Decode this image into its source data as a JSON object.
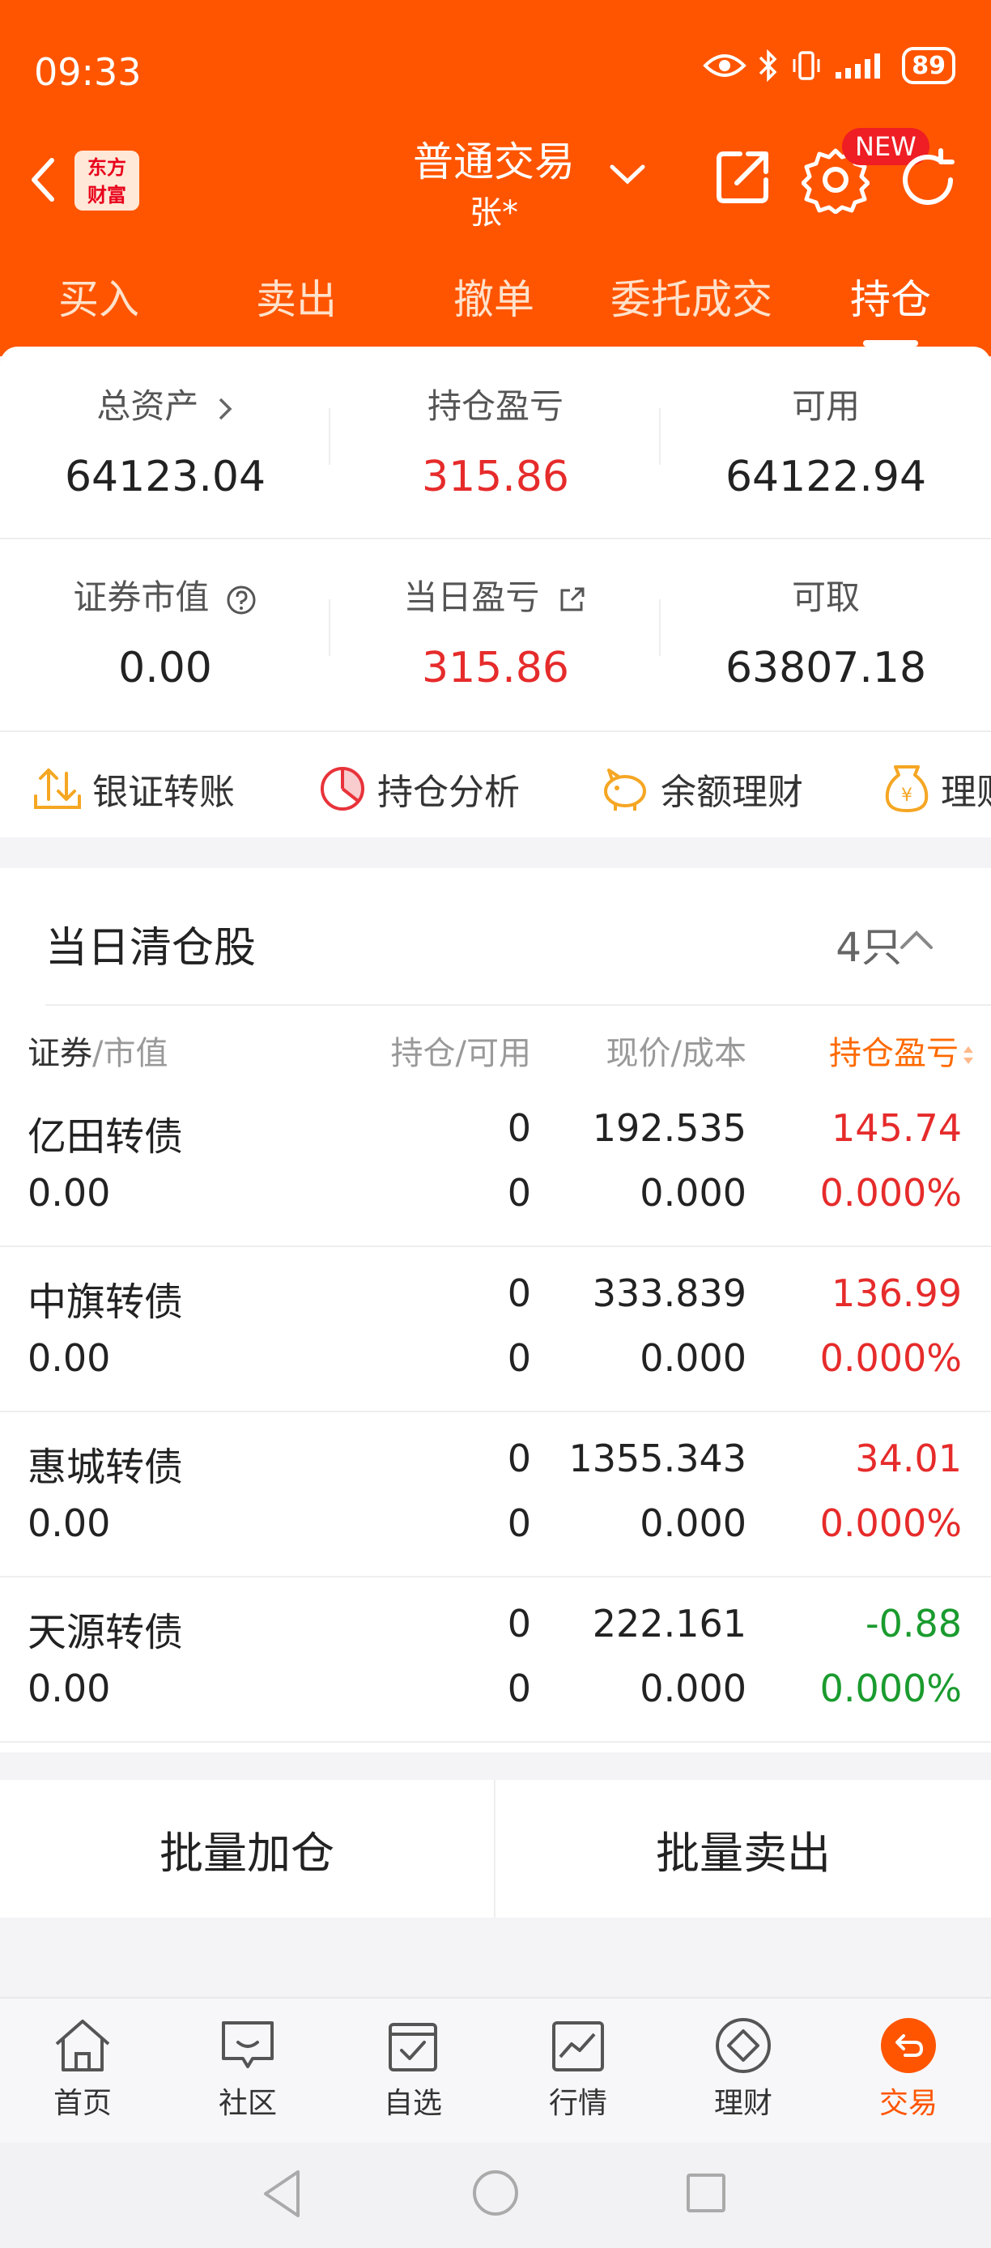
{
  "status_bar": {
    "time": "09:33",
    "battery": "89",
    "indicators": [
      "eye-icon",
      "bluetooth-icon",
      "vibrate-icon",
      "signal-icon"
    ]
  },
  "header": {
    "title": "普通交易",
    "subtitle": "张*",
    "logo_text_1": "东方",
    "logo_text_2": "财富",
    "new_badge": "NEW"
  },
  "tabs": [
    {
      "label": "买入"
    },
    {
      "label": "卖出"
    },
    {
      "label": "撤单"
    },
    {
      "label": "委托成交"
    },
    {
      "label": "持仓",
      "active": true
    }
  ],
  "summary": {
    "total_assets_label": "总资产",
    "total_assets": "64123.04",
    "position_pl_label": "持仓盈亏",
    "position_pl": "315.86",
    "available_label": "可用",
    "available": "64122.94",
    "market_value_label": "证券市值",
    "market_value": "0.00",
    "daily_pl_label": "当日盈亏",
    "daily_pl": "315.86",
    "withdrawable_label": "可取",
    "withdrawable": "63807.18"
  },
  "quick_actions": [
    {
      "label": "银证转账",
      "icon": "transfer-icon"
    },
    {
      "label": "持仓分析",
      "icon": "pie-chart-icon"
    },
    {
      "label": "余额理财",
      "icon": "piggy-bank-icon"
    },
    {
      "label": "理财",
      "icon": "money-bag-icon"
    }
  ],
  "cleared_panel": {
    "title": "当日清仓股",
    "count": "4只",
    "columns": {
      "security_a": "证券",
      "security_b": "/市值",
      "position": "持仓/可用",
      "price": "现价/成本",
      "pl": "持仓盈亏"
    },
    "rows": [
      {
        "name": "亿田转债",
        "market_value": "0.00",
        "position": "0",
        "available": "0",
        "price": "192.535",
        "cost": "0.000",
        "pl": "145.74",
        "pl_pct": "0.000%",
        "trend": "up"
      },
      {
        "name": "中旗转债",
        "market_value": "0.00",
        "position": "0",
        "available": "0",
        "price": "333.839",
        "cost": "0.000",
        "pl": "136.99",
        "pl_pct": "0.000%",
        "trend": "up"
      },
      {
        "name": "惠城转债",
        "market_value": "0.00",
        "position": "0",
        "available": "0",
        "price": "1355.343",
        "cost": "0.000",
        "pl": "34.01",
        "pl_pct": "0.000%",
        "trend": "up"
      },
      {
        "name": "天源转债",
        "market_value": "0.00",
        "position": "0",
        "available": "0",
        "price": "222.161",
        "cost": "0.000",
        "pl": "-0.88",
        "pl_pct": "0.000%",
        "trend": "down"
      }
    ]
  },
  "batch": {
    "add_label": "批量加仓",
    "sell_label": "批量卖出"
  },
  "bottom_nav": [
    {
      "label": "首页",
      "icon": "home-icon"
    },
    {
      "label": "社区",
      "icon": "chat-icon"
    },
    {
      "label": "自选",
      "icon": "checkbox-icon"
    },
    {
      "label": "行情",
      "icon": "line-chart-icon"
    },
    {
      "label": "理财",
      "icon": "diamond-icon"
    },
    {
      "label": "交易",
      "icon": "trade-icon",
      "active": true
    }
  ],
  "colors": {
    "brand": "#ff5500",
    "up": "#e62b2b",
    "down": "#1a9b2e"
  }
}
